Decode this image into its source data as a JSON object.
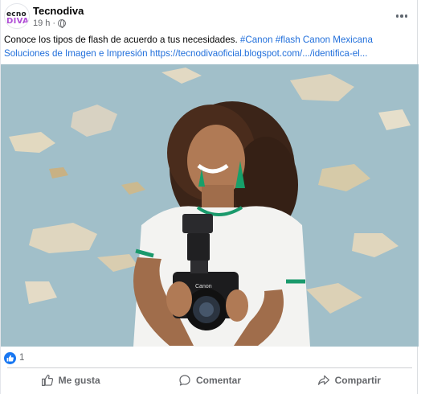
{
  "post": {
    "page_name": "Tecnodiva",
    "avatar_line1": "ecno",
    "avatar_line2": "DIVA",
    "time": "19 h",
    "time_sep": "·",
    "text_plain": "Conoce los tipos  de flash de acuerdo a tus necesidades. ",
    "hashtags": "#Canon #flash Canon Mexicana Soluciones de Imagen e Impresión",
    "link": "https://tecnodivaoficial.blogspot.com/.../identifica-el...",
    "photo_alt": "Mujer sonriente sosteniendo una cámara Canon con flash",
    "camera_brand": "Canon"
  },
  "reactions": {
    "icon": "like-icon",
    "count": "1"
  },
  "actions": {
    "like": "Me gusta",
    "comment": "Comentar",
    "share": "Compartir"
  },
  "colors": {
    "link": "#216fdb",
    "muted": "#65676b",
    "like_blue": "#1877f2"
  }
}
